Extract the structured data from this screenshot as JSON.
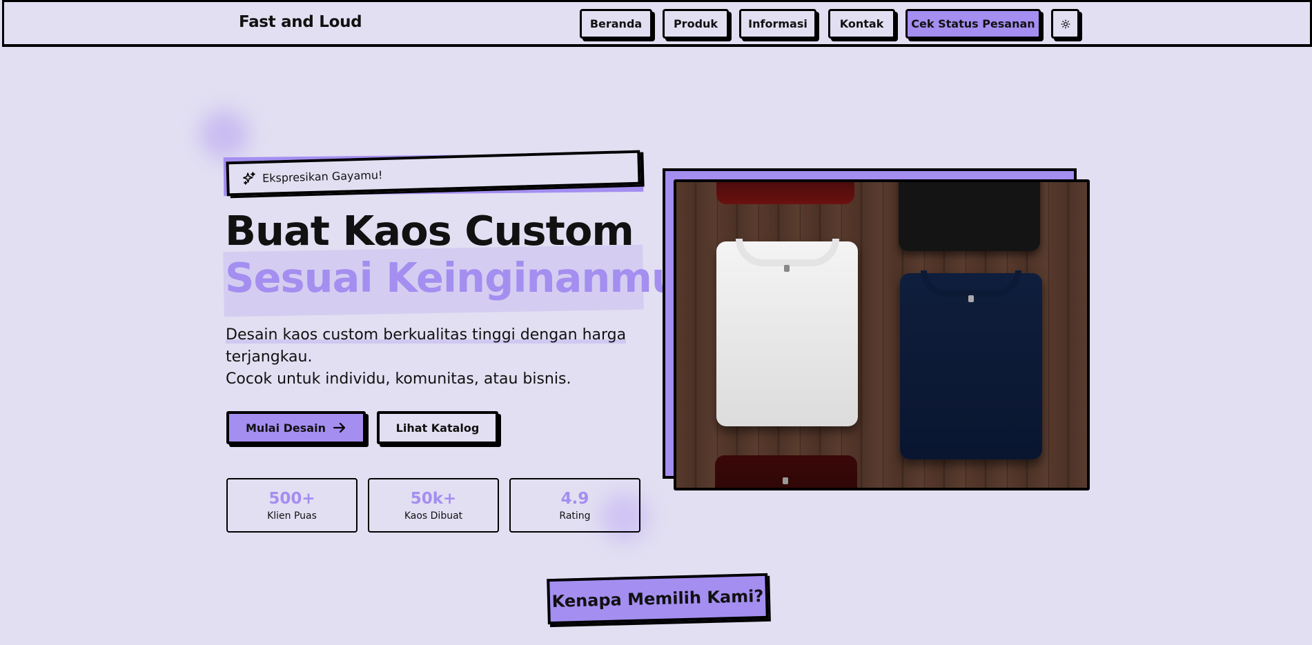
{
  "brand": "Fast and Loud",
  "nav": {
    "items": [
      "Beranda",
      "Produk",
      "Informasi",
      "Kontak"
    ],
    "cta": "Cek Status Pesanan",
    "theme_toggle_icon": "sun-icon"
  },
  "hero": {
    "tag": "Ekspresikan Gayamu!",
    "tag_icon": "sparkles-icon",
    "title_line1": "Buat Kaos Custom",
    "title_line2": "Sesuai Keinginanmu",
    "description_line1": "Desain kaos custom berkualitas tinggi dengan harga terjangkau.",
    "description_line2": "Cocok untuk individu, komunitas, atau bisnis.",
    "primary_button": "Mulai Desain",
    "secondary_button": "Lihat Katalog",
    "stats": [
      {
        "value": "500+",
        "label": "Klien Puas"
      },
      {
        "value": "50k+",
        "label": "Kaos Dibuat"
      },
      {
        "value": "4.9",
        "label": "Rating"
      }
    ]
  },
  "section": {
    "why_title": "Kenapa Memilih Kami?"
  },
  "colors": {
    "background": "#e2dff2",
    "accent": "#a48ef0",
    "border": "#000000"
  }
}
